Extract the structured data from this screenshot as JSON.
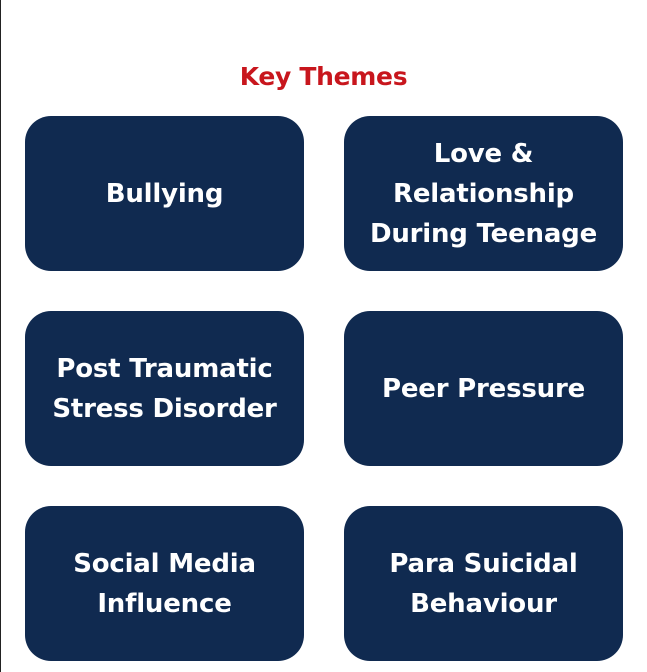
{
  "title": "Key Themes",
  "colors": {
    "title": "#c8161d",
    "card_background": "#102a50",
    "card_text": "#ffffff"
  },
  "themes": [
    {
      "label": "Bullying"
    },
    {
      "label": "Love & Relationship\nDuring Teenage"
    },
    {
      "label": "Post Traumatic\nStress Disorder"
    },
    {
      "label": "Peer Pressure"
    },
    {
      "label": "Social Media\nInfluence"
    },
    {
      "label": "Para Suicidal\nBehaviour"
    }
  ]
}
